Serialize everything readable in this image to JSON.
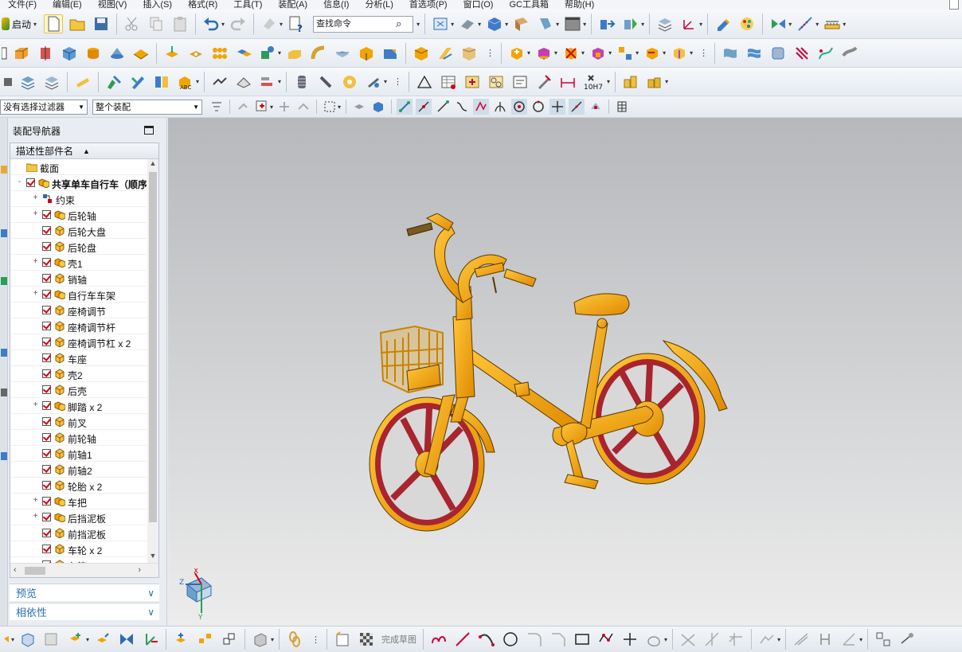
{
  "menubar": {
    "items": [
      "文件(F)",
      "编辑(E)",
      "视图(V)",
      "插入(S)",
      "格式(R)",
      "工具(T)",
      "装配(A)",
      "信息(I)",
      "分析(L)",
      "首选项(P)",
      "窗口(O)",
      "GC工具箱",
      "帮助(H)"
    ]
  },
  "toolbar": {
    "start_label": "启动",
    "find_command_placeholder": "查找命令",
    "selection_filter": "没有选择过滤器",
    "assembly_scope": "整个装配",
    "fit_label": "10H7"
  },
  "navigator": {
    "title": "装配导航器",
    "column_header": "描述性部件名",
    "rows": [
      {
        "label": "截面",
        "level": 0,
        "expand": "",
        "checked": false,
        "icon": "folder"
      },
      {
        "label": "共享单车自行车（顺序",
        "level": 0,
        "expand": "-",
        "checked": true,
        "icon": "assembly",
        "bold": true
      },
      {
        "label": "约束",
        "level": 1,
        "expand": "+",
        "checked": false,
        "icon": "constraint"
      },
      {
        "label": "后轮轴",
        "level": 1,
        "expand": "+",
        "checked": true,
        "icon": "assembly"
      },
      {
        "label": "后轮大盘",
        "level": 1,
        "expand": "",
        "checked": true,
        "icon": "part"
      },
      {
        "label": "后轮盘",
        "level": 1,
        "expand": "",
        "checked": true,
        "icon": "part"
      },
      {
        "label": "壳1",
        "level": 1,
        "expand": "+",
        "checked": true,
        "icon": "assembly"
      },
      {
        "label": "销轴",
        "level": 1,
        "expand": "",
        "checked": true,
        "icon": "part"
      },
      {
        "label": "自行车车架",
        "level": 1,
        "expand": "+",
        "checked": true,
        "icon": "assembly"
      },
      {
        "label": "座椅调节",
        "level": 1,
        "expand": "",
        "checked": true,
        "icon": "part"
      },
      {
        "label": "座椅调节杆",
        "level": 1,
        "expand": "",
        "checked": true,
        "icon": "part"
      },
      {
        "label": "座椅调节杠 x 2",
        "level": 1,
        "expand": "",
        "checked": true,
        "icon": "part"
      },
      {
        "label": "车座",
        "level": 1,
        "expand": "",
        "checked": true,
        "icon": "part"
      },
      {
        "label": "壳2",
        "level": 1,
        "expand": "",
        "checked": true,
        "icon": "part"
      },
      {
        "label": "后壳",
        "level": 1,
        "expand": "",
        "checked": true,
        "icon": "part"
      },
      {
        "label": "脚踏 x 2",
        "level": 1,
        "expand": "+",
        "checked": true,
        "icon": "assembly"
      },
      {
        "label": "前叉",
        "level": 1,
        "expand": "",
        "checked": true,
        "icon": "part"
      },
      {
        "label": "前轮轴",
        "level": 1,
        "expand": "",
        "checked": true,
        "icon": "part"
      },
      {
        "label": "前轴1",
        "level": 1,
        "expand": "",
        "checked": true,
        "icon": "part"
      },
      {
        "label": "前轴2",
        "level": 1,
        "expand": "",
        "checked": true,
        "icon": "part"
      },
      {
        "label": "轮胎 x 2",
        "level": 1,
        "expand": "",
        "checked": true,
        "icon": "part"
      },
      {
        "label": "车把",
        "level": 1,
        "expand": "+",
        "checked": true,
        "icon": "assembly"
      },
      {
        "label": "后挡泥板",
        "level": 1,
        "expand": "+",
        "checked": true,
        "icon": "assembly"
      },
      {
        "label": "前挡泥板",
        "level": 1,
        "expand": "",
        "checked": true,
        "icon": "part"
      },
      {
        "label": "车轮 x 2",
        "level": 1,
        "expand": "",
        "checked": true,
        "icon": "part"
      },
      {
        "label": "车筐",
        "level": 1,
        "expand": "",
        "checked": true,
        "icon": "part"
      }
    ],
    "preview_label": "预览",
    "dependency_label": "相依性"
  },
  "viewport": {
    "triad_labels": {
      "x": "X",
      "y": "Y",
      "z": "Z"
    }
  },
  "bottom_toolbar": {
    "sketch_done_label": "完成草图"
  },
  "colors": {
    "part_orange": "#f2a400",
    "rim_red": "#a8242f",
    "check_red": "#d4000a",
    "panel_blue": "#2a6fb5"
  }
}
